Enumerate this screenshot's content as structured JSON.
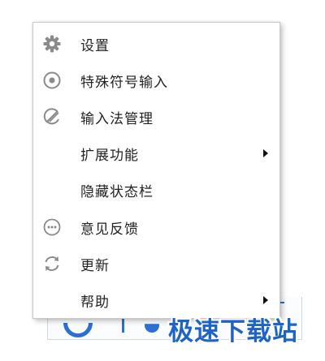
{
  "menu": {
    "items": [
      {
        "label": "设置",
        "icon": "gear-icon",
        "has_submenu": false
      },
      {
        "label": "特殊符号输入",
        "icon": "target-circle-icon",
        "has_submenu": false
      },
      {
        "label": "输入法管理",
        "icon": "pen-slash-icon",
        "has_submenu": false
      },
      {
        "label": "扩展功能",
        "icon": "",
        "has_submenu": true
      },
      {
        "label": "隐藏状态栏",
        "icon": "",
        "has_submenu": false
      },
      {
        "label": "意见反馈",
        "icon": "ellipsis-circle-icon",
        "has_submenu": false
      },
      {
        "label": "更新",
        "icon": "refresh-icon",
        "has_submenu": false
      },
      {
        "label": "帮助",
        "icon": "",
        "has_submenu": true
      }
    ]
  },
  "watermark": {
    "text": "极速下载站"
  },
  "colors": {
    "icon_gray": "#8a8a8a",
    "watermark_blue": "#1e63c6",
    "text": "#222222"
  }
}
